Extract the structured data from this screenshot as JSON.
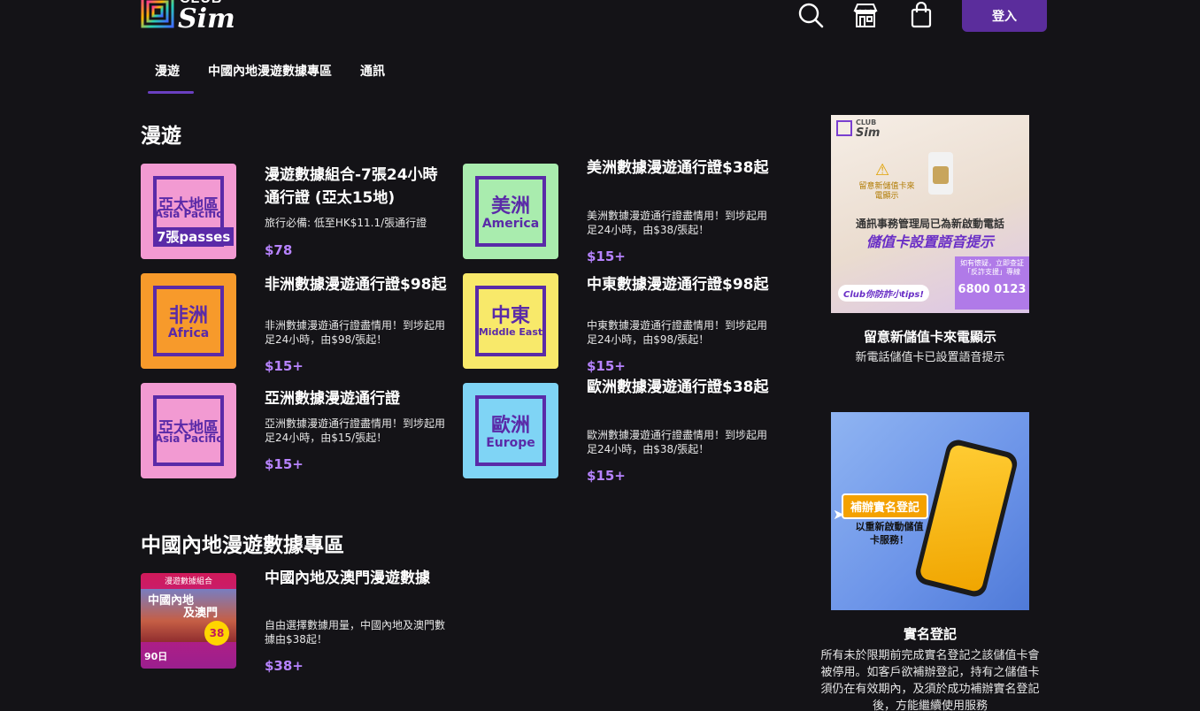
{
  "header": {
    "logo_club": "CLUB",
    "logo_sim": "Sim",
    "icons": [
      "search-icon",
      "store-icon",
      "shopping-bag-icon"
    ],
    "login_label": "登入"
  },
  "tabs": [
    {
      "label": "漫遊",
      "active": true
    },
    {
      "label": "中國內地漫遊數據專區",
      "active": false
    },
    {
      "label": "通訊",
      "active": false
    }
  ],
  "roaming": {
    "title": "漫遊",
    "cards": [
      {
        "title": "漫遊數據組合-7張24小時通行證 (亞太15地)",
        "desc": "旅行必備: 低至HK$11.1/張通行證",
        "price": "$78",
        "thumb_zh": "亞太地區",
        "thumb_en": "Asia Pacific",
        "thumb_extra": "7張passes",
        "thumb_color": "#f29ad2"
      },
      {
        "title": "美洲數據漫遊通行證$38起",
        "desc": "美洲數據漫遊通行證盡情用！到埗起用足24小時，由$38/張起！",
        "price": "$15+",
        "thumb_zh": "美洲",
        "thumb_en": "America",
        "thumb_color": "#a9ecae"
      },
      {
        "title": "非洲數據漫遊通行證$98起",
        "desc": "非洲數據漫遊通行證盡情用！到埗起用足24小時，由$98/張起！",
        "price": "$15+",
        "thumb_zh": "非洲",
        "thumb_en": "Africa",
        "thumb_color": "#f79a2b"
      },
      {
        "title": "中東數據漫遊通行證$98起",
        "desc": "中東數據漫遊通行證盡情用！到埗起用足24小時，由$98/張起！",
        "price": "$15+",
        "thumb_zh": "中東",
        "thumb_en": "Middle East",
        "thumb_color": "#f8e96a"
      },
      {
        "title": "亞洲數據漫遊通行證",
        "desc": "亞洲數據漫遊通行證盡情用！到埗起用足24小時，由$15/張起！",
        "price": "$15+",
        "thumb_zh": "亞太地區",
        "thumb_en": "Asia Pacific",
        "thumb_color": "#f29ad2"
      },
      {
        "title": "歐洲數據漫遊通行證$38起",
        "desc": "歐洲數據漫遊通行證盡情用！到埗起用足24小時，由$38/張起！",
        "price": "$15+",
        "thumb_zh": "歐洲",
        "thumb_en": "Europe",
        "thumb_color": "#7fd4f5"
      }
    ]
  },
  "china": {
    "title": "中國內地漫遊數據專區",
    "card": {
      "title": "中國內地及澳門漫遊數據",
      "desc": "自由選擇數據用量，中國內地及澳門數據由$38起！",
      "price": "$38+",
      "thumb_banner": "漫遊數據組合",
      "thumb_zh1": "中國內地",
      "thumb_zh2": "及澳門",
      "thumb_price": "38",
      "thumb_days": "90日"
    }
  },
  "sidebar": {
    "promo1": {
      "img_club": "CLUB",
      "img_sim": "Sim",
      "img_warn": "留意新儲值卡來電顯示",
      "img_line1": "通訊事務管理局已為新啟動電話",
      "img_line2": "儲值卡設置語音提示",
      "img_tip": "Club你防詐小tips!",
      "img_hotline_label": "如有懷疑，立即查証「反詐支援」專線",
      "img_hotline": "6800 0123",
      "title": "留意新儲值卡來電顯示",
      "sub": "新電話儲值卡已設置語音提示"
    },
    "promo2": {
      "img_tag": "補辦實名登記",
      "img_text": "以重新啟動儲值卡服務！",
      "title": "實名登記",
      "sub": "所有未於限期前完成實名登記之該儲值卡會被停用。如客戶欲補辦登記，持有之儲值卡須仍在有效期內，及須於成功補辦實名登記後，方能繼續使用服務"
    }
  },
  "colors": {
    "accent": "#5b2d9c",
    "price": "#b783ff",
    "background": "#141317"
  }
}
